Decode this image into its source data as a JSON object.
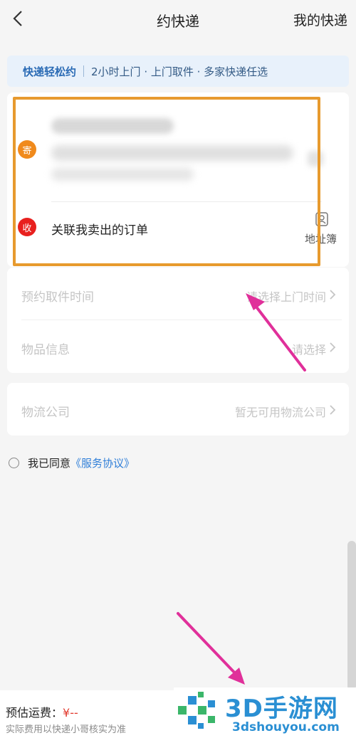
{
  "nav": {
    "title": "约快递",
    "right_label": "我的快递"
  },
  "banner": {
    "highlight": "快递轻松约",
    "features": "2小时上门 · 上门取件 · 多家快递任选"
  },
  "address": {
    "send_badge": "寄",
    "recv_badge": "收",
    "recv_text": "关联我卖出的订单",
    "address_book_label": "地址簿"
  },
  "form": {
    "pickup_time_label": "预约取件时间",
    "pickup_time_value": "请选择上门时间",
    "item_info_label": "物品信息",
    "item_info_value": "请选择",
    "courier_label": "物流公司",
    "courier_value": "暂无可用物流公司"
  },
  "agreement": {
    "prefix": "我已同意",
    "link": "《服务协议》"
  },
  "footer": {
    "fee_label": "预估运费：",
    "fee_value": "¥--",
    "fee_note": "实际费用以快递小哥核实为准"
  },
  "watermark": {
    "title": "3D手游网",
    "subtitle": "3dshouyou.com"
  },
  "colors": {
    "accent_blue": "#2f7ed8",
    "highlight_orange": "#e79a2e",
    "annotation_arrow": "#e0309a"
  }
}
